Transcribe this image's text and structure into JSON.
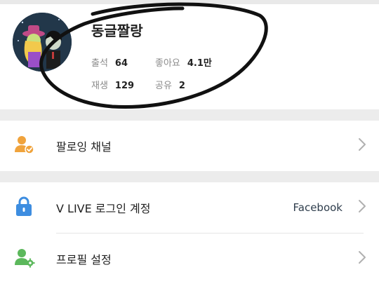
{
  "profile": {
    "nickname": "동글짤랑",
    "stats": {
      "attendance": {
        "label": "출석",
        "value": "64"
      },
      "likes": {
        "label": "좋아요",
        "value": "4.1만"
      },
      "plays": {
        "label": "재생",
        "value": "129"
      },
      "shares": {
        "label": "공유",
        "value": "2"
      }
    }
  },
  "menu": {
    "following": {
      "label": "팔로잉 채널",
      "icon": "user-check-icon"
    },
    "vlive_login": {
      "label": "V LIVE 로그인 계정",
      "value": "Facebook",
      "icon": "lock-icon"
    },
    "profile_settings": {
      "label": "프로필 설정",
      "icon": "user-gear-icon"
    }
  },
  "colors": {
    "orange_icon": "#f0a33c",
    "blue_icon": "#3d8de0",
    "green_icon": "#5cb85c",
    "chevron": "#b0b0b0"
  }
}
